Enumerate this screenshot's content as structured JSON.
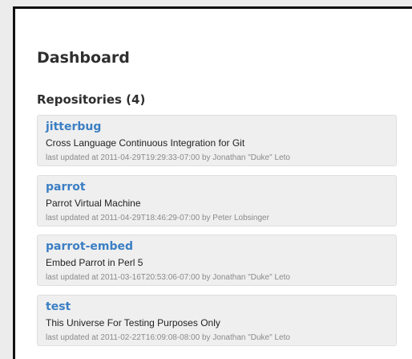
{
  "page": {
    "title": "Dashboard",
    "section_title": "Repositories (4)"
  },
  "repositories": [
    {
      "name": "jitterbug",
      "description": "Cross Language Continuous Integration for Git",
      "updated": "last updated at 2011-04-29T19:29:33-07:00 by Jonathan \"Duke\" Leto"
    },
    {
      "name": "parrot",
      "description": "Parrot Virtual Machine",
      "updated": "last updated at 2011-04-29T18:46:29-07:00 by Peter Lobsinger"
    },
    {
      "name": "parrot-embed",
      "description": "Embed Parrot in Perl 5",
      "updated": "last updated at 2011-03-16T20:53:06-07:00 by Jonathan \"Duke\" Leto"
    },
    {
      "name": "test",
      "description": "This Universe For Testing Purposes Only",
      "updated": "last updated at 2011-02-22T16:09:08-08:00 by Jonathan \"Duke\" Leto"
    }
  ],
  "colors": {
    "link": "#3b7fc4",
    "card_background": "#efefef",
    "page_background": "#ececec"
  }
}
